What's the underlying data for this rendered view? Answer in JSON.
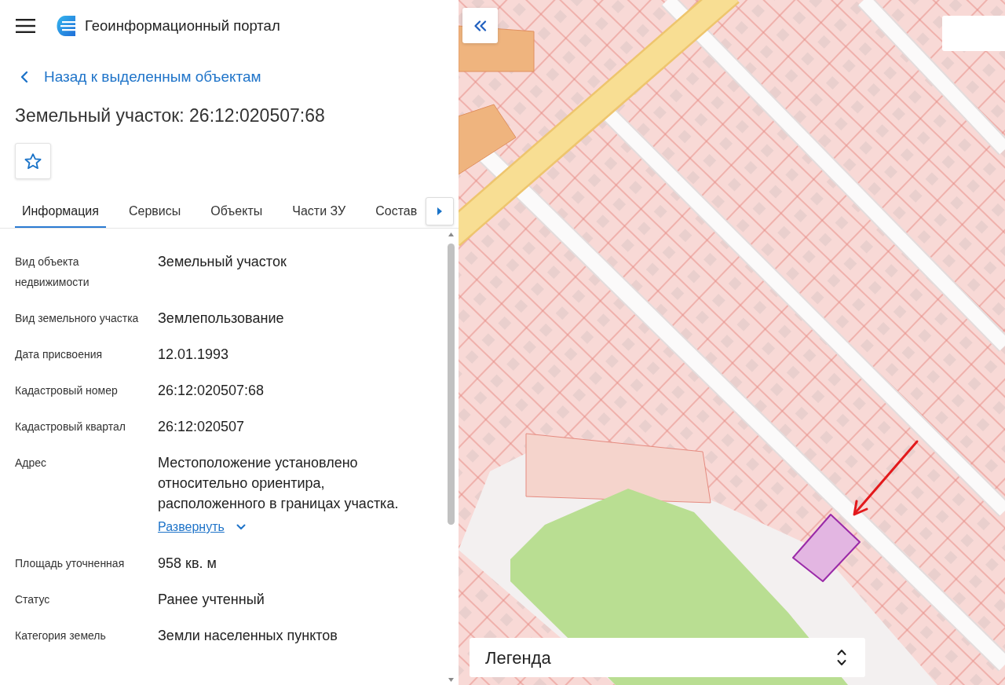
{
  "header": {
    "title": "Геоинформационный портал"
  },
  "back_link": {
    "label": "Назад к выделенным объектам"
  },
  "object": {
    "title": "Земельный участок: 26:12:020507:68"
  },
  "tabs": [
    {
      "label": "Информация",
      "selected": true
    },
    {
      "label": "Сервисы",
      "selected": false
    },
    {
      "label": "Объекты",
      "selected": false
    },
    {
      "label": "Части ЗУ",
      "selected": false
    },
    {
      "label": "Состав",
      "selected": false
    }
  ],
  "fields": [
    {
      "label": "Вид объекта недвижимости",
      "value": "Земельный участок"
    },
    {
      "label": "Вид земельного участка",
      "value": "Землепользование"
    },
    {
      "label": "Дата присвоения",
      "value": "12.01.1993"
    },
    {
      "label": "Кадастровый номер",
      "value": "26:12:020507:68"
    },
    {
      "label": "Кадастровый квартал",
      "value": "26:12:020507"
    },
    {
      "label": "Адрес",
      "value": "Местоположение установлено относительно ориентира, расположенного в границах участка.",
      "expand_link": "Развернуть"
    },
    {
      "label": "Площадь уточненная",
      "value": "958 кв. м"
    },
    {
      "label": "Статус",
      "value": "Ранее учтенный"
    },
    {
      "label": "Категория земель",
      "value": "Земли населенных пунктов"
    }
  ],
  "map": {
    "legend": {
      "title": "Легенда"
    }
  }
}
